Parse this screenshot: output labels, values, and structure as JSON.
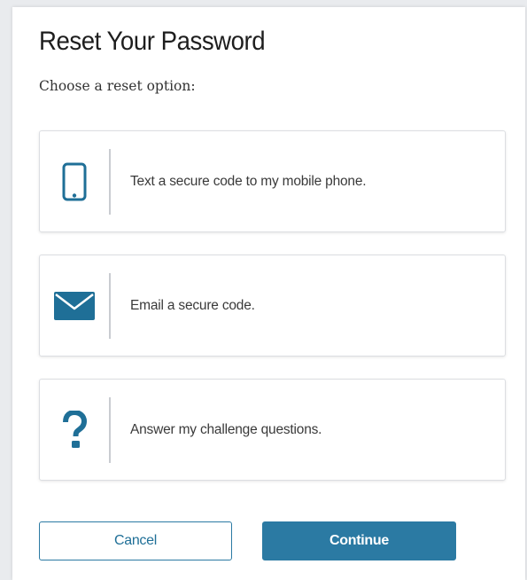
{
  "page": {
    "title": "Reset Your Password",
    "subtitle": "Choose a reset option:"
  },
  "options": [
    {
      "icon": "mobile-phone-icon",
      "label": "Text a secure code to my mobile phone."
    },
    {
      "icon": "envelope-icon",
      "label": "Email a secure code."
    },
    {
      "icon": "question-mark-icon",
      "label": "Answer my challenge questions."
    }
  ],
  "actions": {
    "cancel_label": "Cancel",
    "continue_label": "Continue"
  },
  "colors": {
    "accent": "#2b7aa3",
    "icon": "#1f6f97",
    "divider": "#c9ccd1"
  }
}
